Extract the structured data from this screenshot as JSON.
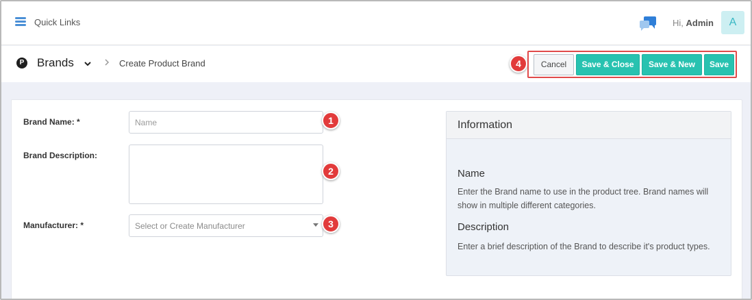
{
  "topbar": {
    "quick_links_label": "Quick Links",
    "greeting_prefix": "Hi,",
    "user_name": "Admin",
    "avatar_initial": "A"
  },
  "header": {
    "page_icon_letter": "P",
    "title": "Brands",
    "breadcrumb_current": "Create Product Brand"
  },
  "actions": {
    "cancel_label": "Cancel",
    "save_close_label": "Save & Close",
    "save_new_label": "Save & New",
    "save_label": "Save"
  },
  "form": {
    "brand_name_label": "Brand Name: *",
    "brand_name_placeholder": "Name",
    "brand_name_value": "",
    "brand_description_label": "Brand Description:",
    "brand_description_value": "",
    "manufacturer_label": "Manufacturer: *",
    "manufacturer_placeholder": "Select or Create Manufacturer"
  },
  "callouts": {
    "one": "1",
    "two": "2",
    "three": "3",
    "four": "4"
  },
  "info": {
    "title": "Information",
    "name_heading": "Name",
    "name_text": "Enter the Brand name to use in the product tree. Brand names will show in multiple different categories.",
    "description_heading": "Description",
    "description_text": "Enter a brief description of the Brand to describe it's product types."
  },
  "colors": {
    "accent_teal": "#28c2b0",
    "callout_red": "#e23b3b",
    "link_blue": "#4a8fd6"
  }
}
